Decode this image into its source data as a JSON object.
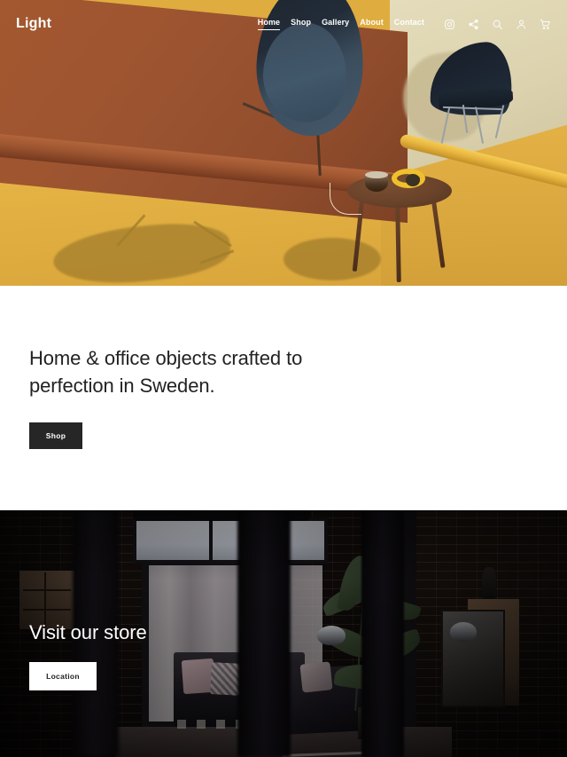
{
  "site": {
    "logo": "Light"
  },
  "nav": {
    "links": [
      {
        "label": "Home",
        "active": true
      },
      {
        "label": "Shop",
        "active": false
      },
      {
        "label": "Gallery",
        "active": false
      },
      {
        "label": "About",
        "active": false
      },
      {
        "label": "Contact",
        "active": false
      }
    ],
    "icons": [
      {
        "name": "instagram-icon",
        "label": "Instagram"
      },
      {
        "name": "share-icon",
        "label": "Share"
      },
      {
        "name": "search-icon",
        "label": "Search"
      },
      {
        "name": "account-icon",
        "label": "Account"
      },
      {
        "name": "cart-icon",
        "label": "Cart"
      }
    ]
  },
  "hero": {
    "alt": "Orange backdrop with yellow floor, hanging egg chair, navy chair and wooden side table"
  },
  "intro": {
    "headline": "Home & office objects crafted to perfection in Sweden.",
    "button_label": "Shop"
  },
  "store": {
    "title": "Visit our store",
    "button_label": "Location",
    "alt": "Dark loft interior with brick walls, sofa, plant and windows"
  },
  "colors": {
    "terracotta": "#9e5531",
    "yellow_floor": "#dfac40",
    "cream_wall": "#ddd3b0",
    "navy_furniture": "#222c38",
    "dark_button": "#262626",
    "white": "#ffffff",
    "text_dark": "#222222"
  }
}
